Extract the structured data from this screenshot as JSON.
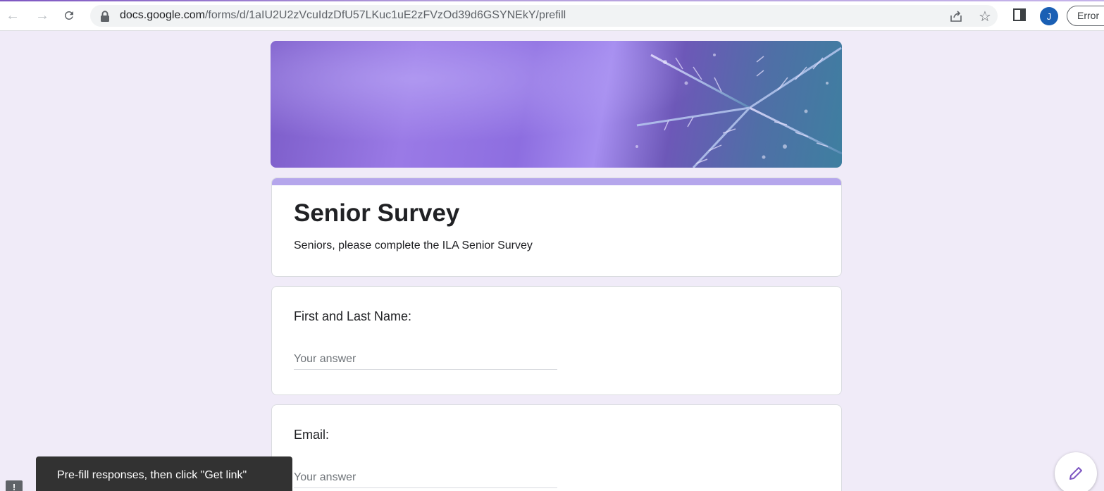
{
  "browser": {
    "url_host": "docs.google.com",
    "url_path": "/forms/d/1aIU2U2zVcuIdzDfU57LKuc1uE2zFVzOd39d6GSYNEkY/prefill",
    "avatar_letter": "J",
    "error_label": "Error"
  },
  "form": {
    "title": "Senior Survey",
    "description": "Seniors, please complete the ILA Senior Survey",
    "accent_color": "#b5a6ec",
    "questions": [
      {
        "label": "First and Last Name:",
        "placeholder": "Your answer"
      },
      {
        "label": "Email:",
        "placeholder": "Your answer"
      }
    ]
  },
  "snackbar": {
    "message": "Pre-fill responses, then click \"Get link\""
  },
  "icons": {
    "back": "arrow-left-icon",
    "forward": "arrow-right-icon",
    "reload": "reload-icon",
    "lock": "lock-icon",
    "share": "share-icon",
    "bookmark": "star-icon",
    "side_panel": "side-panel-icon",
    "feedback": "feedback-icon",
    "edit": "pencil-icon"
  }
}
